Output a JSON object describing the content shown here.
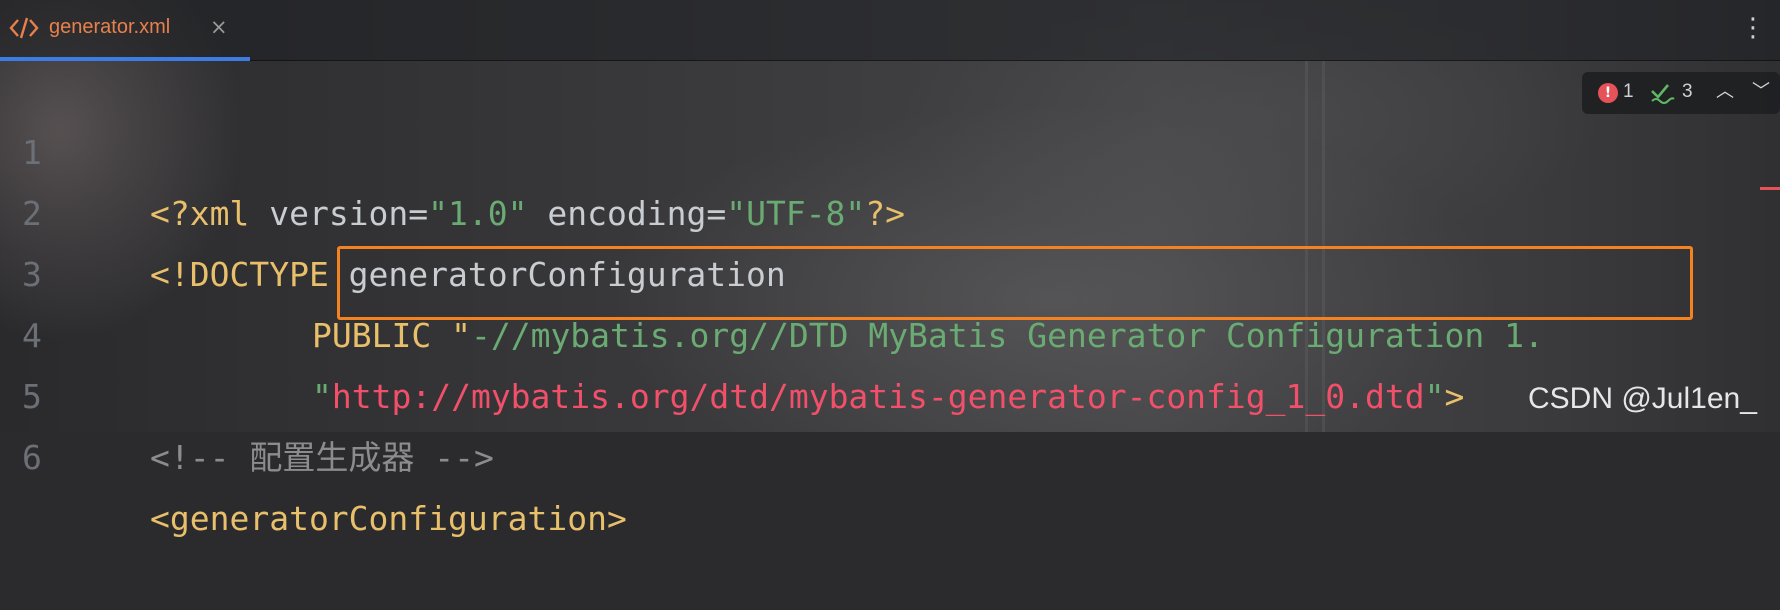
{
  "tab": {
    "label": "generator.xml",
    "icon": "xml-code-icon",
    "close": "×",
    "accent": "#e8804c"
  },
  "toolbar": {
    "more": "⋮"
  },
  "inspections": {
    "errors": "1",
    "weak_warnings": "3",
    "up": "︿",
    "down": "﹀"
  },
  "editor": {
    "lines": [
      {
        "n": "1",
        "parts": [
          "<?xml",
          " version",
          "=",
          "\"1.0\"",
          " encoding",
          "=",
          "\"UTF-8\"",
          "?>"
        ]
      },
      {
        "n": "2",
        "parts": [
          "<!DOCTYPE",
          " generatorConfiguration"
        ]
      },
      {
        "n": "3",
        "parts": [
          "PUBLIC",
          " \"",
          "-//mybatis.org//DTD MyBatis Generator Configuration 1."
        ]
      },
      {
        "n": "4",
        "parts": [
          "\"",
          "http://mybatis.org/dtd/mybatis-generator-config_1_0.dtd",
          "\"",
          ">"
        ]
      },
      {
        "n": "5",
        "parts": [
          "<!-- ",
          "配置生成器",
          " -->"
        ]
      },
      {
        "n": "6",
        "parts": [
          "<generatorConfiguration>"
        ]
      }
    ]
  },
  "colors": {
    "highlight": "#f58220",
    "url": "#f2506a",
    "string": "#6aab73",
    "tag": "#e8bf6a",
    "error": "#e5525a"
  },
  "watermark": "CSDN @Jul1en_"
}
